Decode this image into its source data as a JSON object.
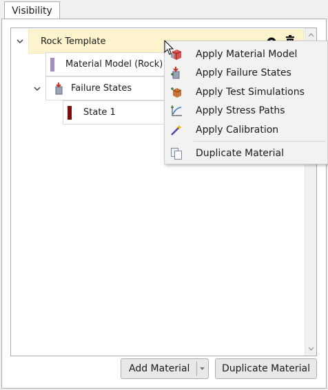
{
  "tab": {
    "label": "Visibility"
  },
  "tree": {
    "root": {
      "label": "Rock Template"
    },
    "material_model": {
      "label": "Material Model (Rock)",
      "color": "#a58fc2"
    },
    "failure_states": {
      "label": "Failure States"
    },
    "state1": {
      "label": "State 1",
      "color": "#7a0c0c"
    }
  },
  "context_menu": {
    "items": [
      {
        "label": "Apply Material Model",
        "icon": "material-model-icon"
      },
      {
        "label": "Apply Failure States",
        "icon": "failure-states-icon"
      },
      {
        "label": "Apply Test Simulations",
        "icon": "test-simulations-icon"
      },
      {
        "label": "Apply Stress Paths",
        "icon": "stress-paths-icon"
      },
      {
        "label": "Apply Calibration",
        "icon": "calibration-wand-icon"
      },
      {
        "label": "Duplicate Material",
        "icon": "duplicate-icon"
      }
    ]
  },
  "buttons": {
    "add_material": "Add Material",
    "duplicate_material": "Duplicate Material"
  }
}
